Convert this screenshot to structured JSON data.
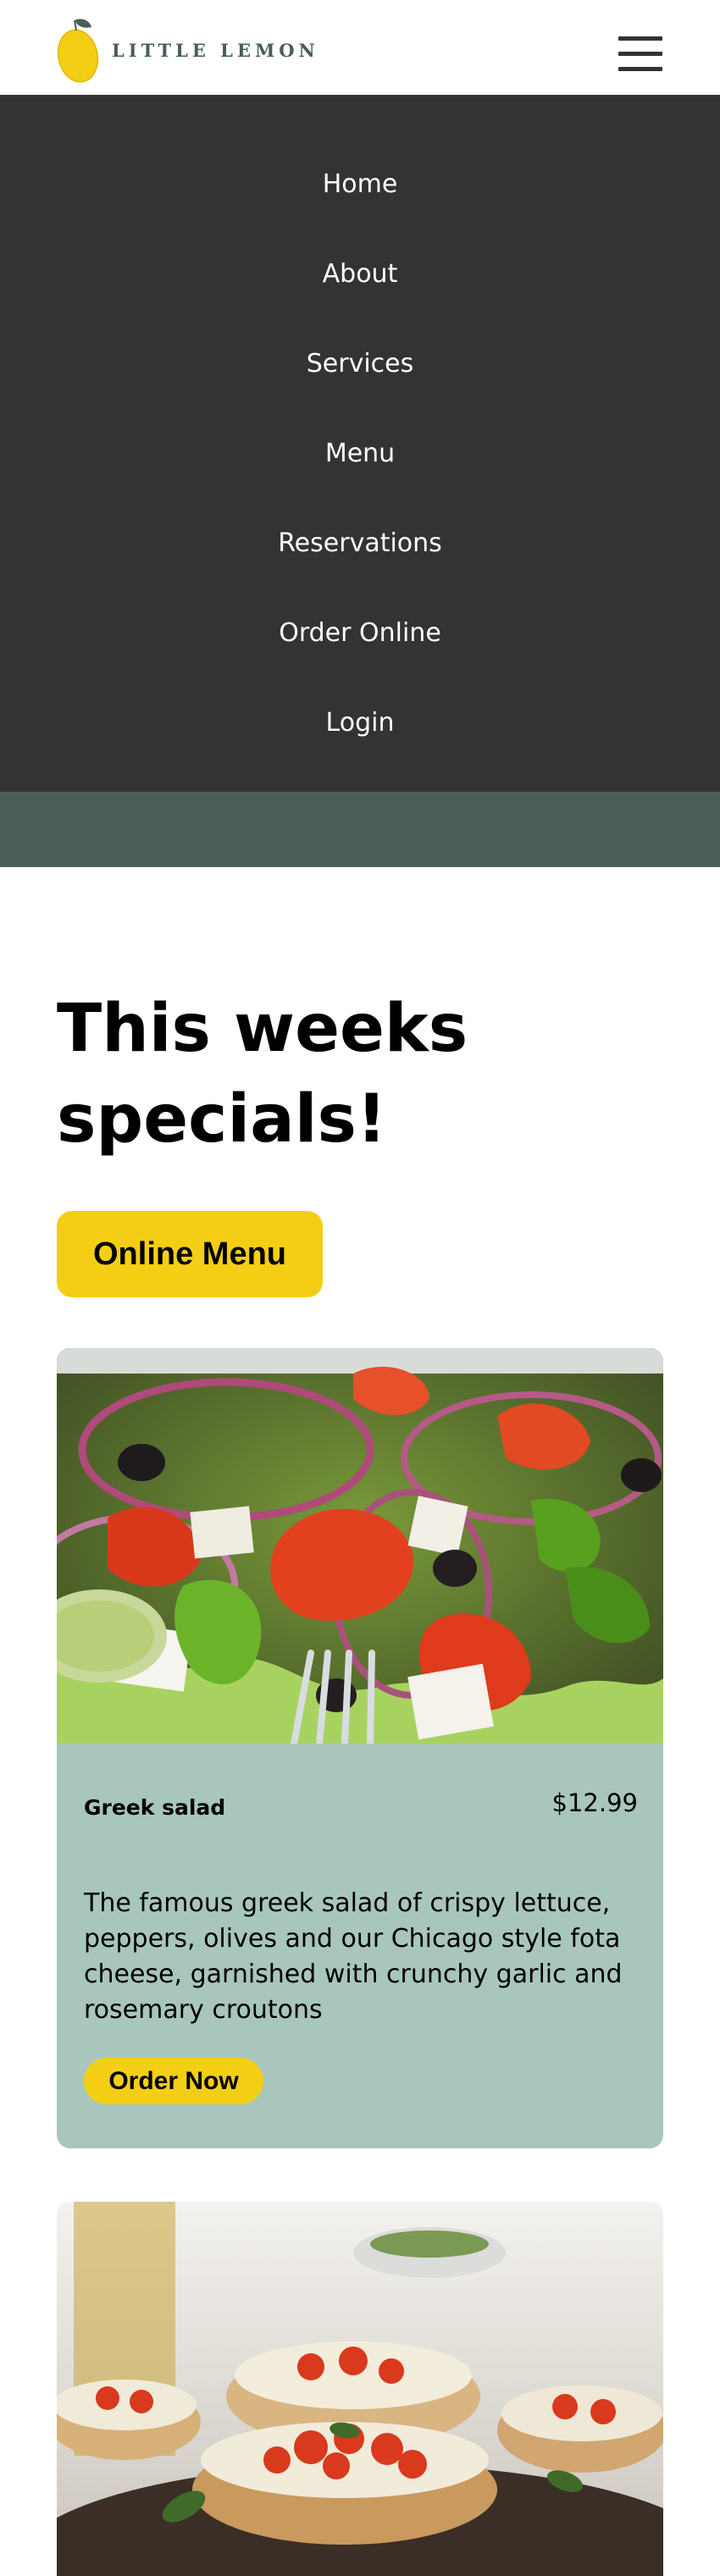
{
  "brand": {
    "name": "LITTLE LEMON",
    "logo_icon": "lemon-logo-icon",
    "color": "#495e57"
  },
  "header": {
    "menu_icon": "hamburger-menu-icon"
  },
  "nav": {
    "items": [
      {
        "label": "Home"
      },
      {
        "label": "About"
      },
      {
        "label": "Services"
      },
      {
        "label": "Menu"
      },
      {
        "label": "Reservations"
      },
      {
        "label": "Order Online"
      },
      {
        "label": "Login"
      }
    ]
  },
  "specials": {
    "title": "This weeks specials!",
    "online_menu_label": "Online Menu"
  },
  "cards": [
    {
      "name": "Greek salad",
      "price": "$12.99",
      "description": "The famous greek salad of crispy lettuce, peppers, olives and our Chicago style fota cheese, garnished with crunchy garlic and rosemary croutons",
      "order_label": "Order Now",
      "image": "greek-salad-photo"
    },
    {
      "image": "bruschetta-photo"
    }
  ],
  "colors": {
    "accent": "#f4ce14",
    "nav_bg": "#333333",
    "card_bg": "#a8c6bc",
    "band": "#495e57"
  }
}
